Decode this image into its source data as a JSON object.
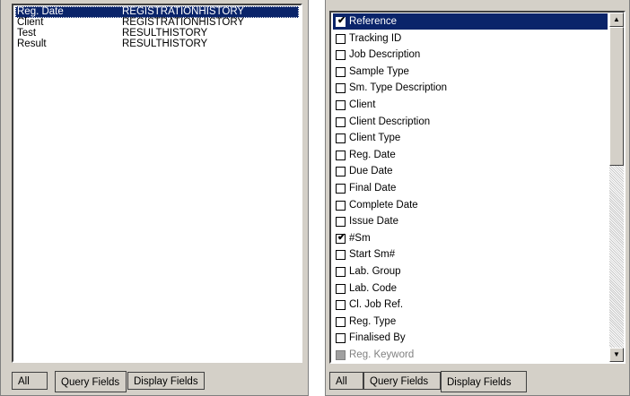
{
  "left": {
    "rows": [
      {
        "field": "Reg. Date",
        "table": "REGISTRATIONHISTORY",
        "selected": true
      },
      {
        "field": "Client",
        "table": "REGISTRATIONHISTORY",
        "selected": false
      },
      {
        "field": "Test",
        "table": "RESULTHISTORY",
        "selected": false
      },
      {
        "field": "Result",
        "table": "RESULTHISTORY",
        "selected": false
      }
    ],
    "tabs": [
      "All",
      "Query Fields",
      "Display Fields"
    ],
    "active_tab": "Query Fields"
  },
  "right": {
    "items": [
      {
        "label": "Reference",
        "checked": true,
        "selected": true
      },
      {
        "label": "Tracking ID",
        "checked": false
      },
      {
        "label": "Job Description",
        "checked": false
      },
      {
        "label": "Sample Type",
        "checked": false
      },
      {
        "label": "Sm. Type Description",
        "checked": false
      },
      {
        "label": "Client",
        "checked": false
      },
      {
        "label": "Client Description",
        "checked": false
      },
      {
        "label": "Client Type",
        "checked": false
      },
      {
        "label": "Reg. Date",
        "checked": false
      },
      {
        "label": "Due Date",
        "checked": false
      },
      {
        "label": "Final Date",
        "checked": false
      },
      {
        "label": "Complete Date",
        "checked": false
      },
      {
        "label": "Issue Date",
        "checked": false
      },
      {
        "label": "#Sm",
        "checked": true
      },
      {
        "label": "Start Sm#",
        "checked": false
      },
      {
        "label": "Lab. Group",
        "checked": false
      },
      {
        "label": "Lab. Code",
        "checked": false
      },
      {
        "label": "Cl. Job Ref.",
        "checked": false
      },
      {
        "label": "Reg. Type",
        "checked": false
      },
      {
        "label": "Finalised By",
        "checked": false
      },
      {
        "label": "Reg. Keyword",
        "checked": false,
        "disabled": true
      }
    ],
    "tabs": [
      "All",
      "Query Fields",
      "Display Fields"
    ],
    "active_tab": "Display Fields",
    "scroll_position": 0.0
  },
  "icons": {
    "scroll_up": "scroll-up-arrow-icon",
    "scroll_down": "scroll-down-arrow-icon",
    "check": "checkmark-icon"
  }
}
